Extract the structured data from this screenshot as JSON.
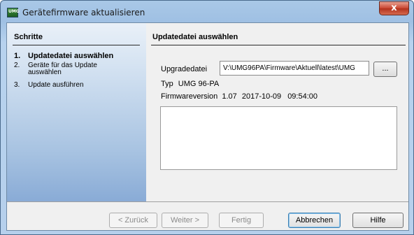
{
  "window": {
    "title": "Gerätefirmware aktualisieren",
    "icon_text": "UMG",
    "close_label": "x"
  },
  "steps": {
    "title": "Schritte",
    "items": [
      {
        "num": "1.",
        "label": "Updatedatei auswählen",
        "active": true
      },
      {
        "num": "2.",
        "label": "Geräte für das Update auswählen",
        "active": false
      },
      {
        "num": "3.",
        "label": "Update ausführen",
        "active": false
      }
    ]
  },
  "content": {
    "title": "Updatedatei auswählen",
    "upgrade_label": "Upgradedatei",
    "upgrade_value": "V:\\UMG96PA\\Firmware\\Aktuell\\latest\\UMG",
    "browse_label": "...",
    "type_label": "Typ",
    "type_value": "UMG 96-PA",
    "firmware_label": "Firmwareversion",
    "firmware_version": "1.07",
    "firmware_date": "2017-10-09",
    "firmware_time": "09:54:00"
  },
  "footer": {
    "back": "< Zurück",
    "next": "Weiter >",
    "finish": "Fertig",
    "cancel": "Abbrechen",
    "help": "Hilfe"
  }
}
